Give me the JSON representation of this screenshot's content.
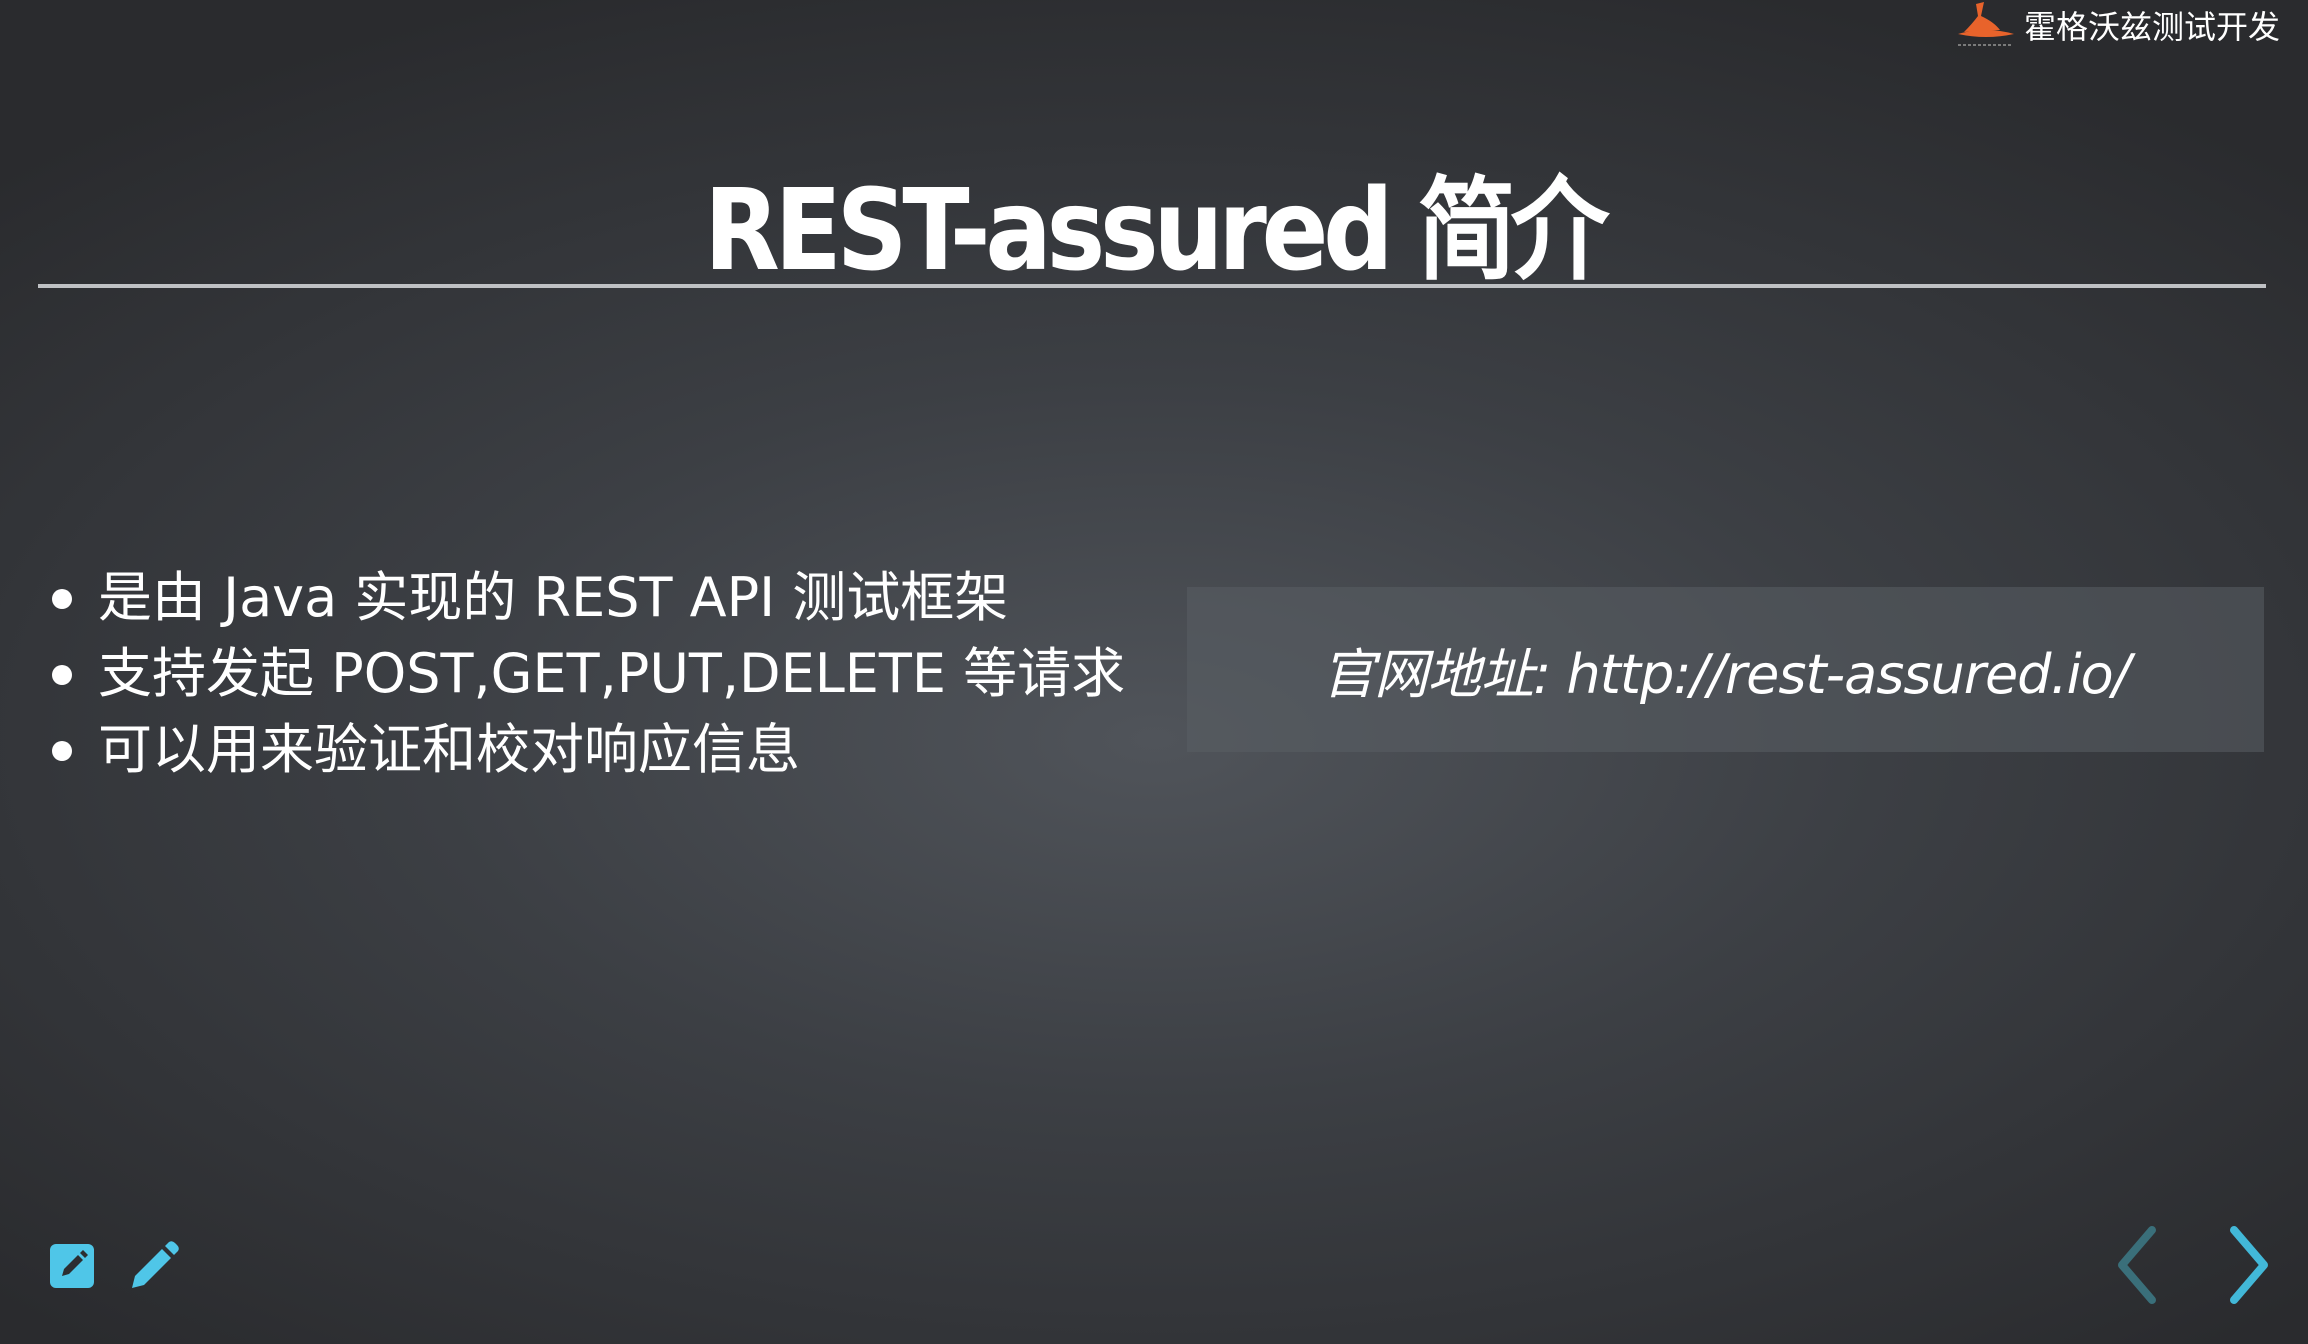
{
  "brand": {
    "name": "霍格沃兹测试开发",
    "logo_icon": "wizard-hat-icon"
  },
  "slide": {
    "title": "REST-assured 简介",
    "bullets": [
      "是由 Java 实现的 REST API 测试框架",
      "支持发起 POST,GET,PUT,DELETE 等请求",
      "可以用来验证和校对响应信息"
    ],
    "url_note": "官网地址: http://rest-assured.io/"
  },
  "toolbar": {
    "notes_icon": "speaker-notes-icon",
    "pen_icon": "pencil-icon"
  },
  "navigation": {
    "prev_icon": "chevron-left-icon",
    "next_icon": "chevron-right-icon"
  },
  "colors": {
    "accent": "#42affa",
    "nav_disabled": "#3a6f7a",
    "rule": "#bfc1c4",
    "logo": "#e8632b"
  }
}
